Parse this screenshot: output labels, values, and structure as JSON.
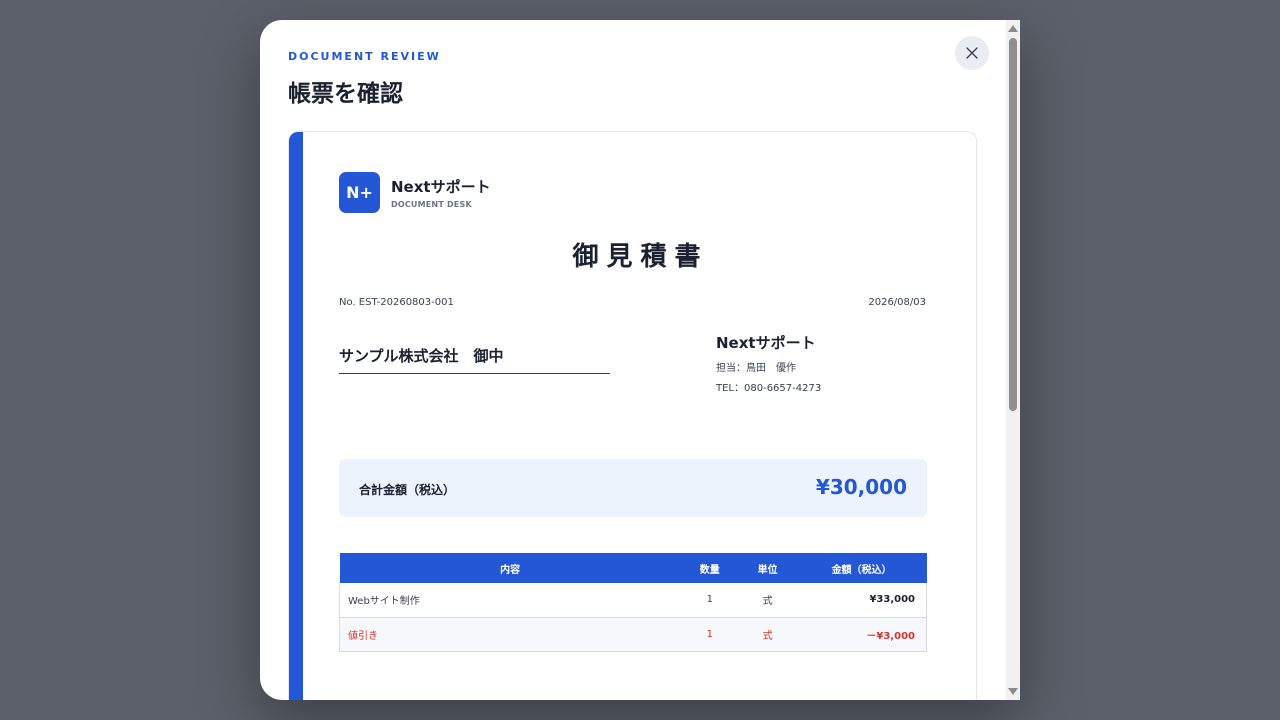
{
  "modal": {
    "eyebrow": "DOCUMENT REVIEW",
    "title": "帳票を確認",
    "close_icon": "close-icon"
  },
  "document": {
    "logo_text": "N+",
    "brand_name": "Nextサポート",
    "brand_sub": "DOCUMENT DESK",
    "title": "御見積書",
    "number": "No. EST-20260803-001",
    "date": "2026/08/03",
    "client": "サンプル株式会社　御中",
    "issuer": {
      "name": "Nextサポート",
      "contact": "担当：鳥田　優作",
      "tel": "TEL：080-6657-4273"
    },
    "total": {
      "label": "合計金額（税込）",
      "value": "¥30,000"
    },
    "table": {
      "headers": [
        "内容",
        "数量",
        "単位",
        "金額（税込）"
      ],
      "rows": [
        {
          "desc": "Webサイト制作",
          "qty": "1",
          "unit": "式",
          "amount": "¥33,000"
        },
        {
          "desc": "値引き",
          "qty": "1",
          "unit": "式",
          "amount": "－¥3,000"
        }
      ]
    }
  },
  "colors": {
    "accent": "#2457d6",
    "discount": "#d0342c",
    "backdrop": "#5b606a"
  }
}
